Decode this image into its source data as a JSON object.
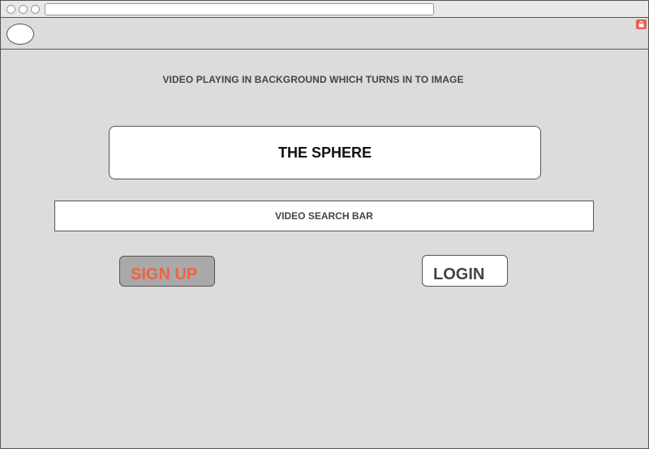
{
  "background_note": "VIDEO PLAYING IN BACKGROUND WHICH TURNS IN TO IMAGE",
  "site_title": "THE SPHERE",
  "search": {
    "label": "VIDEO SEARCH BAR"
  },
  "buttons": {
    "signup_label": "SIGN UP",
    "login_label": "LOGIN"
  },
  "colors": {
    "background": "#dcdcdc",
    "signup_text": "#f0623f",
    "signup_fill": "#a9a9a9",
    "lock_badge": "#e8604c"
  },
  "icons": {
    "profile": "avatar-circle",
    "lock": "lock-icon"
  }
}
